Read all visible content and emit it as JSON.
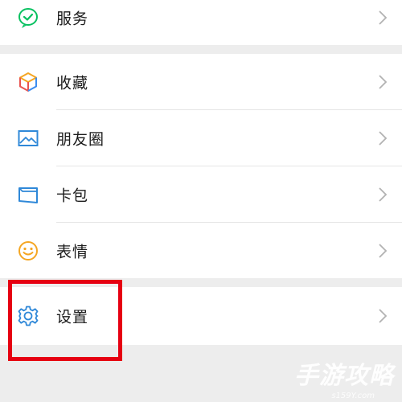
{
  "menu": {
    "services": {
      "label": "服务",
      "icon": "services-check-icon"
    },
    "favorites": {
      "label": "收藏",
      "icon": "favorites-cube-icon"
    },
    "moments": {
      "label": "朋友圈",
      "icon": "moments-picture-icon"
    },
    "cards": {
      "label": "卡包",
      "icon": "card-wallet-icon"
    },
    "stickers": {
      "label": "表情",
      "icon": "sticker-smile-icon"
    },
    "settings": {
      "label": "设置",
      "icon": "settings-gear-icon"
    }
  },
  "annotation": {
    "highlight_color": "#e60012",
    "target": "settings"
  },
  "watermark": {
    "text": "手游攻略",
    "site": "s159Y.com"
  },
  "colors": {
    "background": "#ededed",
    "row": "#ffffff",
    "chevron": "#b2b2b2",
    "green": "#07c160"
  }
}
